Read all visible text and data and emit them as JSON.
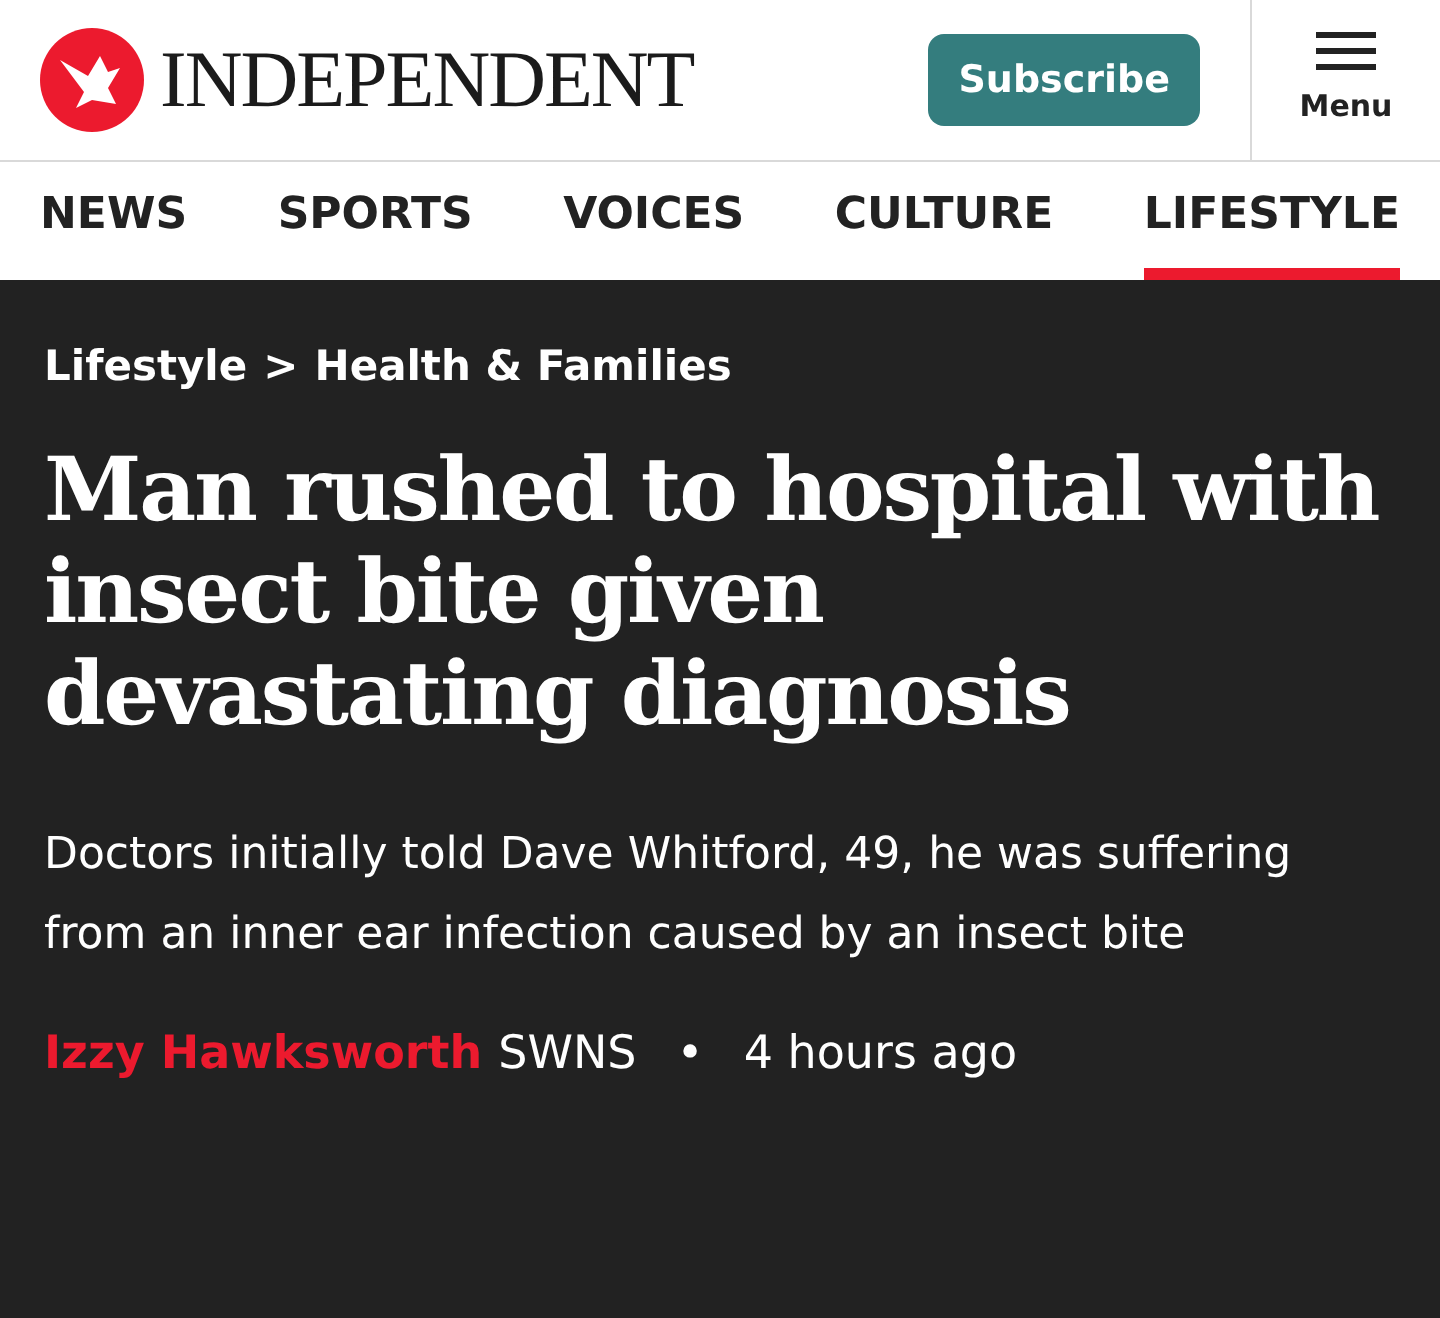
{
  "header": {
    "logo_text": "INDEPENDENT",
    "subscribe": "Subscribe",
    "menu": "Menu"
  },
  "nav": [
    {
      "label": "NEWS",
      "selected": false
    },
    {
      "label": "SPORTS",
      "selected": false
    },
    {
      "label": "VOICES",
      "selected": false
    },
    {
      "label": "CULTURE",
      "selected": false
    },
    {
      "label": "LIFESTYLE",
      "selected": true
    }
  ],
  "article": {
    "breadcrumb": [
      "Lifestyle",
      ">",
      "Health & Families"
    ],
    "headline": "Man rushed to hospital with insect bite given devastating diagnosis",
    "standfirst": "Doctors initially told Dave Whitford, 49, he was suffering from an inner ear infection caused by an insect bite",
    "author": "Izzy Hawksworth",
    "source": "SWNS",
    "separator": "•",
    "time": "4 hours ago"
  }
}
